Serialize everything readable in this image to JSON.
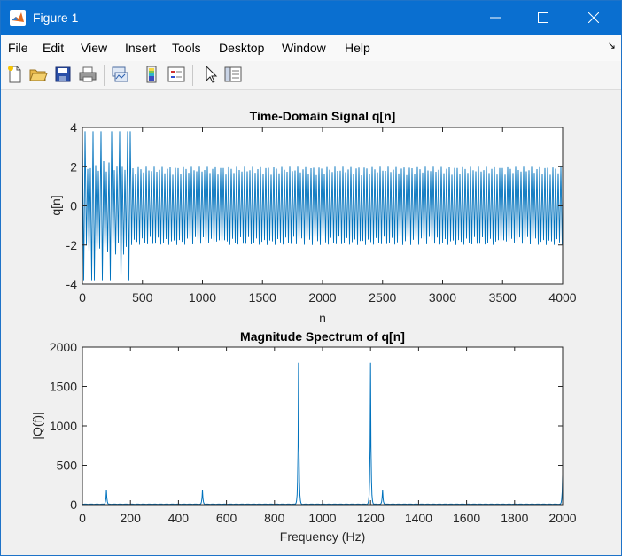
{
  "window": {
    "title": "Figure 1",
    "controls": [
      "minimize",
      "maximize",
      "close"
    ]
  },
  "menu": {
    "items": [
      "File",
      "Edit",
      "View",
      "Insert",
      "Tools",
      "Desktop",
      "Window",
      "Help"
    ]
  },
  "toolbar": {
    "icons": [
      "new-figure-icon",
      "open-file-icon",
      "save-icon",
      "print-icon",
      "link-plot-icon",
      "colorbar-icon",
      "legend-icon",
      "pointer-icon",
      "property-inspector-icon"
    ]
  },
  "colors": {
    "titlebar": "#0a6fd0",
    "line": "#0072bd",
    "axes_bg": "#ffffff"
  },
  "chart_data": [
    {
      "type": "line",
      "title": "Time-Domain Signal q[n]",
      "xlabel": "n",
      "ylabel": "q[n]",
      "xlim": [
        0,
        4000
      ],
      "ylim": [
        -4,
        4
      ],
      "xticks": [
        0,
        500,
        1000,
        1500,
        2000,
        2500,
        3000,
        3500,
        4000
      ],
      "yticks": [
        -4,
        -2,
        0,
        2,
        4
      ],
      "grid": false,
      "segments": [
        {
          "n_range": [
            0,
            400
          ],
          "peak_amplitude": 4,
          "typical_amplitude": 2.5
        },
        {
          "n_range": [
            400,
            4000
          ],
          "peak_amplitude": 2,
          "typical_amplitude": 1.8
        }
      ],
      "series": [
        {
          "values": []
        }
      ]
    },
    {
      "type": "line",
      "title": "Magnitude Spectrum of q[n]",
      "xlabel": "Frequency (Hz)",
      "ylabel": "|Q(f)|",
      "xlim": [
        0,
        2000
      ],
      "ylim": [
        0,
        2000
      ],
      "xticks": [
        0,
        200,
        400,
        600,
        800,
        1000,
        1200,
        1400,
        1600,
        1800,
        2000
      ],
      "yticks": [
        0,
        500,
        1000,
        1500,
        2000
      ],
      "grid": false,
      "peaks": [
        {
          "f": 100,
          "magnitude": 190
        },
        {
          "f": 500,
          "magnitude": 190
        },
        {
          "f": 900,
          "magnitude": 1800
        },
        {
          "f": 1200,
          "magnitude": 1800
        },
        {
          "f": 1250,
          "magnitude": 190
        },
        {
          "f": 2000,
          "magnitude": 380
        }
      ]
    }
  ]
}
